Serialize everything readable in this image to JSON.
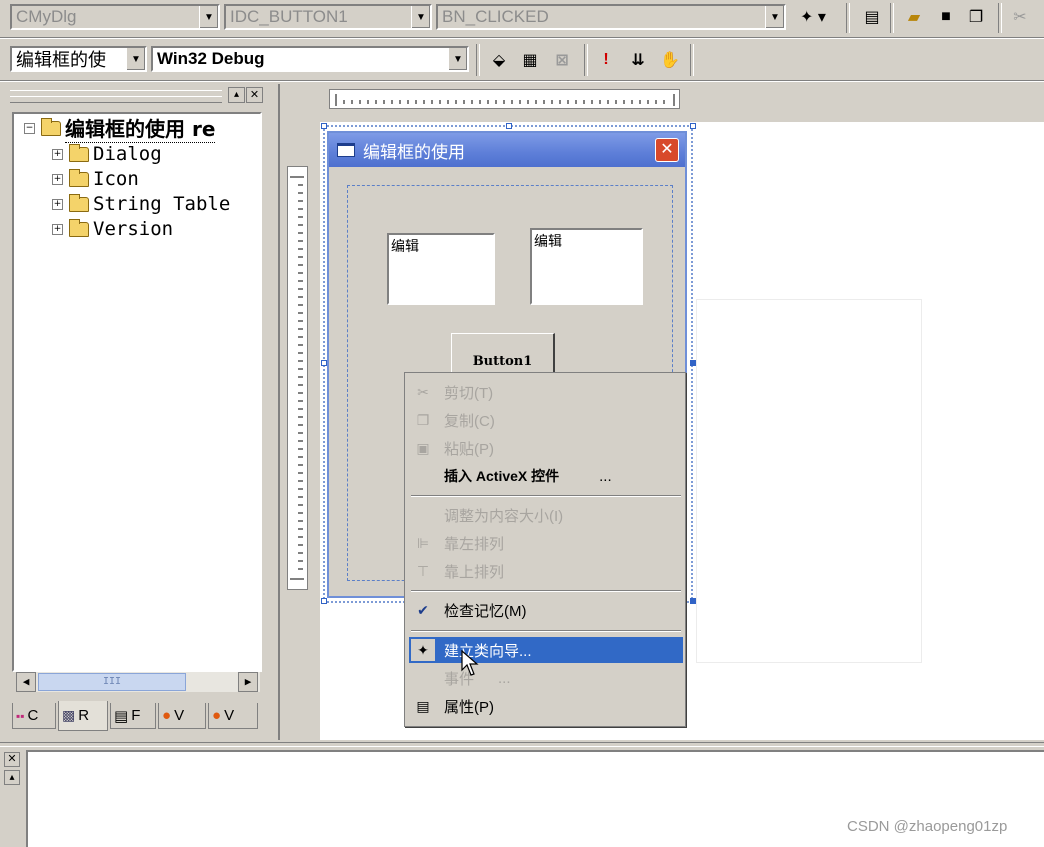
{
  "toolbar1": {
    "class_combo": "CMyDlg",
    "id_combo": "IDC_BUTTON1",
    "message_combo": "BN_CLICKED"
  },
  "toolbar2": {
    "project_combo": "编辑框的使",
    "config_combo": "Win32 Debug"
  },
  "workspace": {
    "root_label": "编辑框的使用 re",
    "items": [
      {
        "label": "Dialog"
      },
      {
        "label": "Icon"
      },
      {
        "label": "String Table"
      },
      {
        "label": "Version"
      }
    ],
    "scroll_thumb_label": "III",
    "tabs": [
      {
        "label": "C"
      },
      {
        "label": "R"
      },
      {
        "label": "F"
      },
      {
        "label": "V"
      },
      {
        "label": "V"
      }
    ]
  },
  "dialog": {
    "title": "编辑框的使用",
    "edit1": "编辑",
    "edit2": "编辑",
    "button": "Button1"
  },
  "context_menu": {
    "items": [
      {
        "label": "剪切(T)",
        "icon": "scissors-icon",
        "enabled": false
      },
      {
        "label": "复制(C)",
        "icon": "copy-icon",
        "enabled": false
      },
      {
        "label": "粘贴(P)",
        "icon": "paste-icon",
        "enabled": false
      },
      {
        "label": "插入 ActiveX 控件",
        "suffix": "...",
        "enabled": true
      },
      {
        "label": "调整为内容大小(I)",
        "enabled": false
      },
      {
        "label": "靠左排列",
        "icon": "align-left-icon",
        "enabled": false
      },
      {
        "label": "靠上排列",
        "icon": "align-top-icon",
        "enabled": false
      },
      {
        "label": "检查记忆(M)",
        "icon": "check-mnemonics-icon",
        "enabled": true
      },
      {
        "label": "建立类向导...",
        "icon": "class-wizard-icon",
        "enabled": true,
        "highlighted": true
      },
      {
        "label": "事件",
        "suffix": "...",
        "enabled": false
      },
      {
        "label": "属性(P)",
        "icon": "properties-icon",
        "enabled": true
      }
    ]
  },
  "watermark": "CSDN @zhaopeng01zp",
  "colors": {
    "highlight": "#3169c6",
    "caption": "#5d7ed8",
    "face": "#d4d0c8",
    "disabled_text": "#a8a5a0"
  }
}
